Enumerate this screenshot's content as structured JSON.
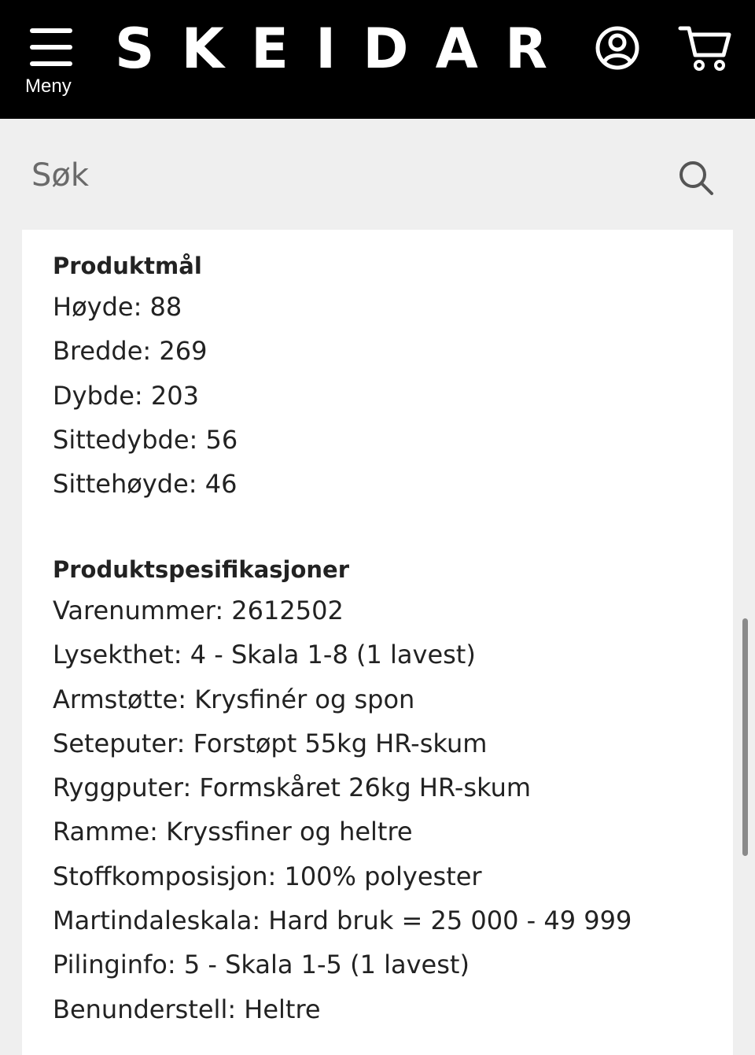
{
  "header": {
    "menu_label": "Meny",
    "logo_letters": [
      "S",
      "K",
      "E",
      "I",
      "D",
      "A",
      "R"
    ]
  },
  "search": {
    "placeholder": "Søk"
  },
  "product_dimensions": {
    "title": "Produktmål",
    "lines": [
      "Høyde: 88",
      "Bredde: 269",
      "Dybde: 203",
      "Sittedybde: 56",
      "Sittehøyde: 46"
    ]
  },
  "product_specs": {
    "title": "Produktspesifikasjoner",
    "lines": [
      "Varenummer: 2612502",
      "Lysekthet: 4 - Skala 1-8 (1 lavest)",
      "Armstøtte: Krysfinér og spon",
      "Seteputer: Forstøpt 55kg HR-skum",
      "Ryggputer: Formskåret 26kg HR-skum",
      "Ramme: Kryssfiner og heltre",
      "Stoffkomposisjon: 100% polyester",
      "Martindaleskala: Hard bruk = 25 000 - 49 999",
      "Pilinginfo: 5 - Skala 1-5 (1 lavest)",
      "Benunderstell: Heltre"
    ]
  },
  "colors": {
    "header_bg": "#000000",
    "page_bg": "#efefef",
    "card_bg": "#ffffff",
    "text": "#222222"
  }
}
